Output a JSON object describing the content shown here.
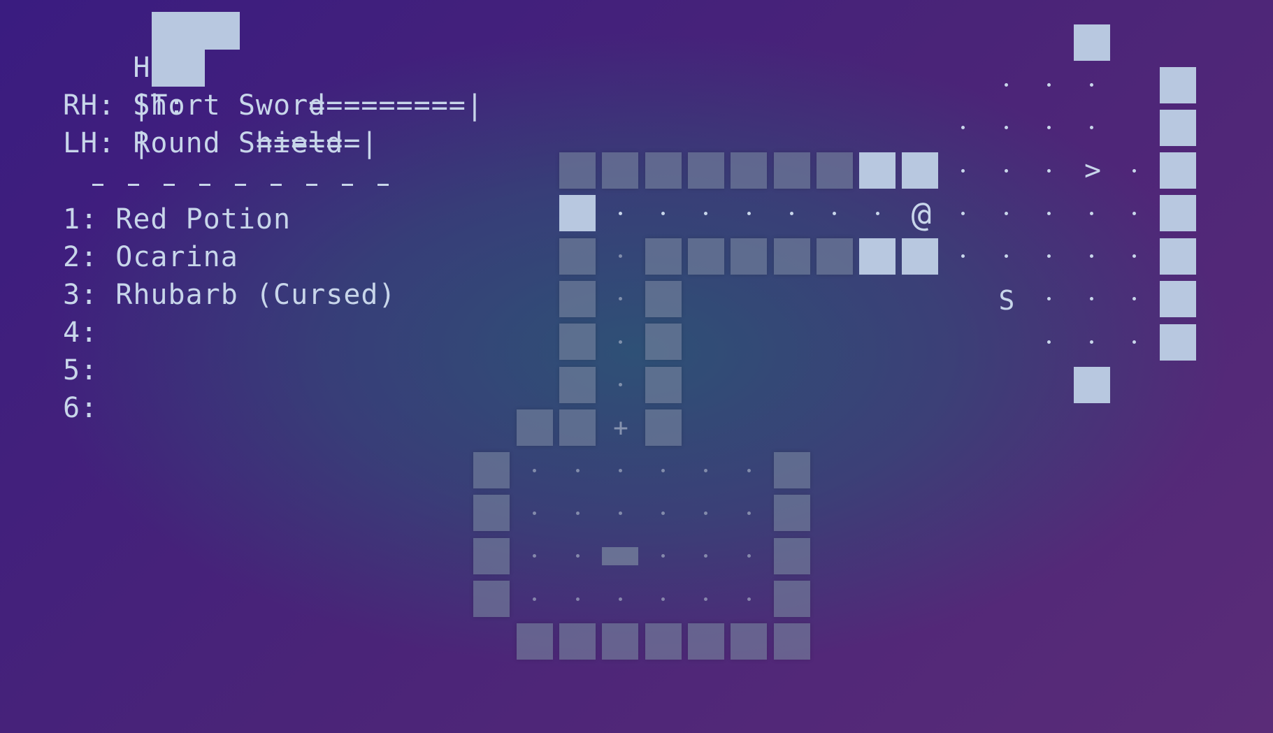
{
  "hud": {
    "hp": {
      "label": "HP:",
      "bar_text": "|         =========|",
      "fill_fraction": 0.5
    },
    "st": {
      "label": "ST:",
      "bar_text": "|      ======|",
      "fill_fraction": 0.5
    },
    "rh": {
      "text": "RH: Short Sword"
    },
    "lh": {
      "text": "LH: Round Shield"
    },
    "inventory": [
      {
        "slot": "1: Red Potion"
      },
      {
        "slot": "2: Ocarina"
      },
      {
        "slot": "3: Rhubarb (Cursed)"
      },
      {
        "slot": "4:"
      },
      {
        "slot": "5:"
      },
      {
        "slot": "6:"
      }
    ]
  },
  "map": {
    "player_glyph": "@",
    "monster_glyph": "S",
    "stairs_glyph": ">",
    "door_glyph": "+",
    "colors": {
      "wall": "#7884a0",
      "lit_wall": "#b8c8e0",
      "text": "#c8d6ea"
    }
  }
}
